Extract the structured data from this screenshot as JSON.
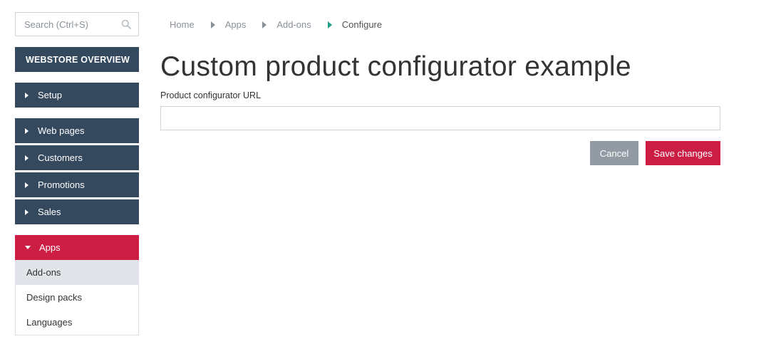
{
  "search": {
    "placeholder": "Search (Ctrl+S)",
    "value": ""
  },
  "sidebar": {
    "overview_label": "WEBSTORE OVERVIEW",
    "items": [
      {
        "label": "Setup"
      },
      {
        "label": "Web pages"
      },
      {
        "label": "Customers"
      },
      {
        "label": "Promotions"
      },
      {
        "label": "Sales"
      },
      {
        "label": "Apps",
        "expanded": true
      }
    ],
    "sub_items": [
      {
        "label": "Add-ons",
        "active": true
      },
      {
        "label": "Design packs"
      },
      {
        "label": "Languages"
      }
    ]
  },
  "breadcrumb": [
    "Home",
    "Apps",
    "Add-ons",
    "Configure"
  ],
  "main": {
    "title": "Custom product configurator example",
    "field_label": "Product configurator URL",
    "field_value": "",
    "cancel_label": "Cancel",
    "save_label": "Save changes"
  },
  "colors": {
    "sidebar_dark": "#34495e",
    "accent_red": "#cc1e45",
    "cancel_gray": "#929ba3",
    "breadcrumb_active": "#1f9e89",
    "sub_item_active": "#e1e4e8"
  },
  "icons": {
    "search": "search-icon",
    "caret_right": "caret-right-icon",
    "caret_down": "caret-down-icon"
  }
}
